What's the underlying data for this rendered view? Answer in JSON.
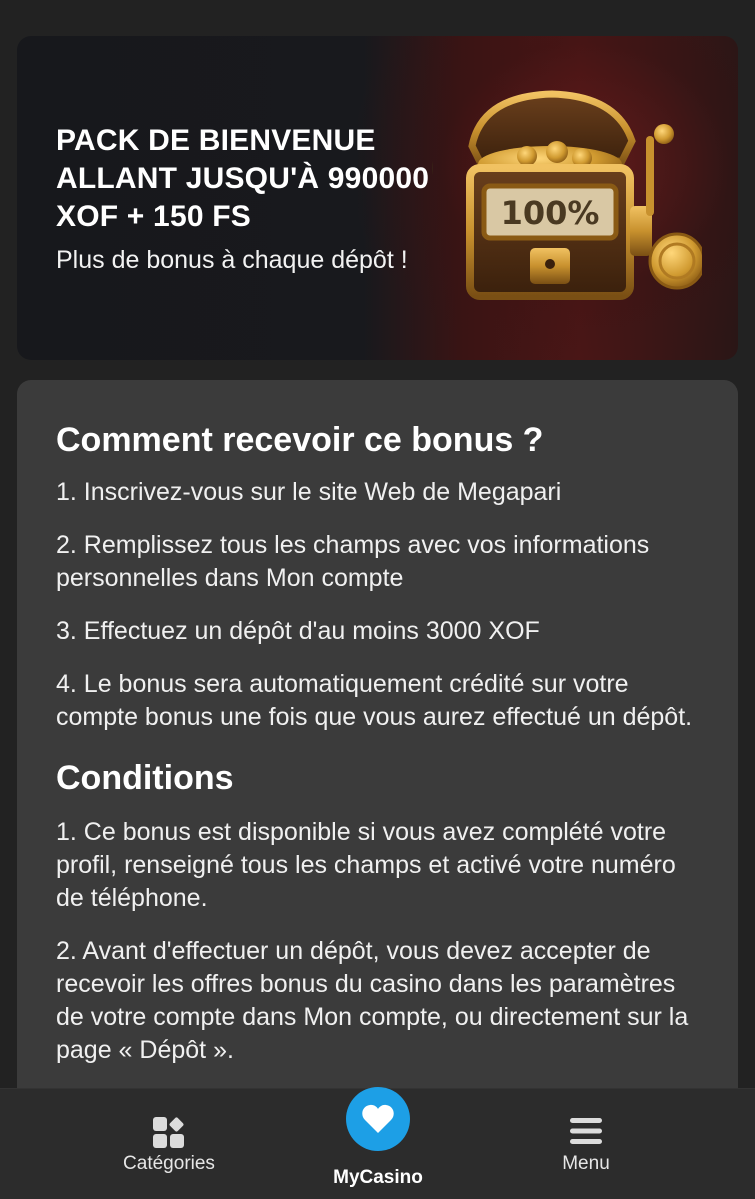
{
  "banner": {
    "title": "PACK DE BIENVENUE\nALLANT JUSQU'À 990000\nXOF + 150 FS",
    "subtitle": "Plus de bonus à chaque dépôt !",
    "reel_text": "100%"
  },
  "how_to": {
    "heading": "Comment recevoir ce bonus ?",
    "steps": [
      "1. Inscrivez-vous sur le site Web de Megapari",
      "2. Remplissez tous les champs avec vos informations personnelles dans Mon compte",
      "3. Effectuez un dépôt d'au moins 3000 XOF",
      "4. Le bonus sera automatiquement crédité sur votre compte bonus une fois que vous aurez effectué un dépôt."
    ]
  },
  "conditions": {
    "heading": "Conditions",
    "items": [
      "1. Ce bonus est disponible si vous avez complété votre profil, renseigné tous les champs et activé votre numéro de téléphone.",
      "2. Avant d'effectuer un dépôt, vous devez accepter de recevoir les offres bonus du casino dans les paramètres de votre compte dans Mon compte, ou directement sur la page « Dépôt »."
    ]
  },
  "nav": {
    "categories_label": "Catégories",
    "mycasino_label": "MyCasino",
    "menu_label": "Menu"
  },
  "colors": {
    "background": "#222222",
    "card": "#3b3b3b",
    "nav_bar": "#2c2c2c",
    "accent_blue": "#1d9fe6",
    "gold": "#c8912e"
  },
  "icons": {
    "categories": "categories-grid-icon",
    "mycasino": "heart-icon",
    "menu": "hamburger-menu-icon"
  }
}
